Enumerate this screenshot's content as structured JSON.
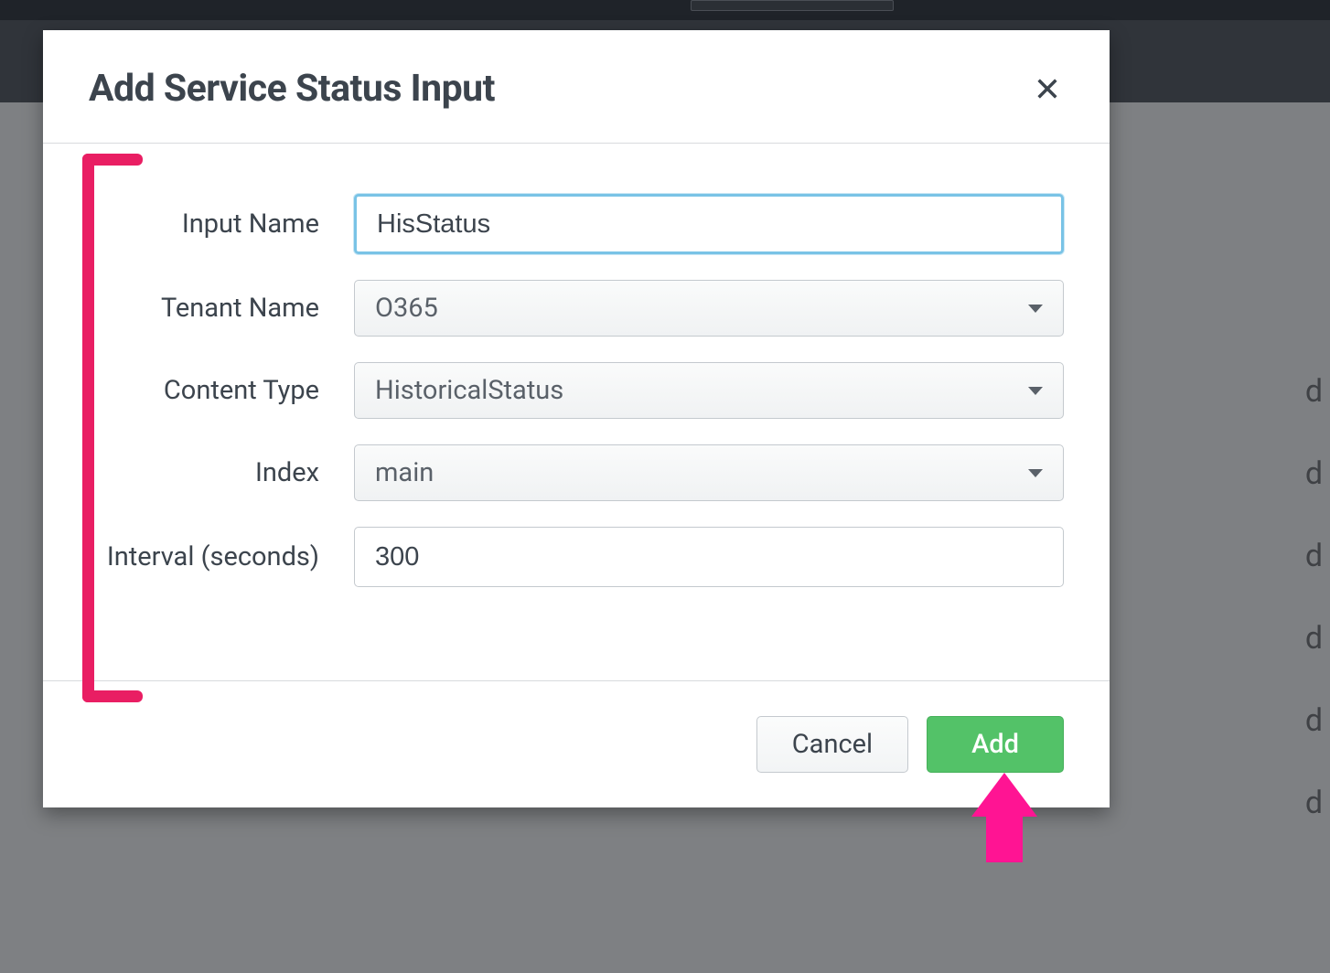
{
  "modal": {
    "title": "Add Service Status Input",
    "fields": {
      "input_name": {
        "label": "Input Name",
        "value": "HisStatus"
      },
      "tenant_name": {
        "label": "Tenant Name",
        "value": "O365"
      },
      "content_type": {
        "label": "Content Type",
        "value": "HistoricalStatus"
      },
      "index": {
        "label": "Index",
        "value": "main"
      },
      "interval": {
        "label": "Interval (seconds)",
        "value": "300"
      }
    },
    "buttons": {
      "cancel": "Cancel",
      "add": "Add"
    }
  },
  "bg_rows": [
    "d",
    "d",
    "d",
    "d",
    "d",
    "d"
  ],
  "colors": {
    "accent_annotation": "#e91e63",
    "accent_arrow": "#ff1493",
    "button_primary": "#53c268",
    "input_focus": "#79c3e6"
  }
}
